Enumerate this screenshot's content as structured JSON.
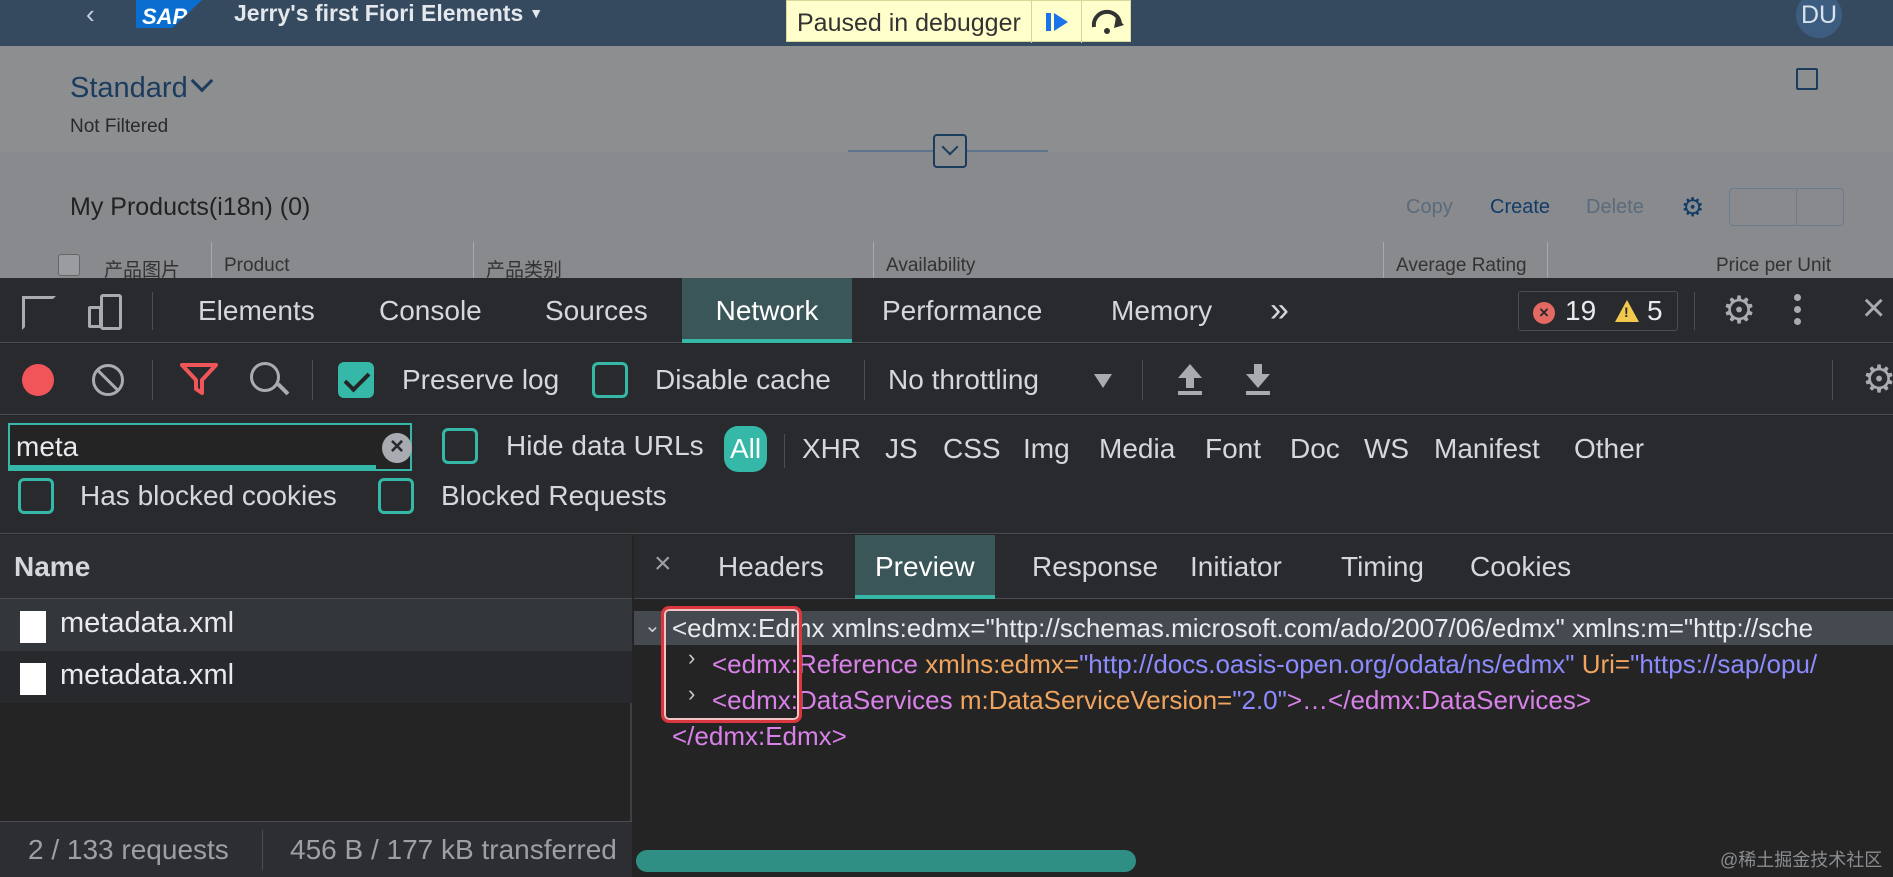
{
  "fiori": {
    "back_icon": "chevron-left-icon",
    "logo_text": "SAP",
    "app_title": "Jerry's first Fiori Elements",
    "debugger_text": "Paused in debugger",
    "avatar_initials": "DU",
    "variant": "Standard",
    "filter_status": "Not Filtered",
    "table_title": "My Products(i18n) (0)",
    "actions": {
      "copy": "Copy",
      "create": "Create",
      "delete": "Delete"
    },
    "columns": [
      "产品图片",
      "Product",
      "产品类别",
      "Availability",
      "Average Rating",
      "Price per Unit"
    ]
  },
  "devtools": {
    "tabs": [
      "Elements",
      "Console",
      "Sources",
      "Network",
      "Performance",
      "Memory"
    ],
    "more_tabs": "»",
    "active_tab": "Network",
    "error_count": "19",
    "warning_count": "5",
    "toolbar": {
      "preserve_log": "Preserve log",
      "preserve_log_checked": true,
      "disable_cache": "Disable cache",
      "throttling": "No throttling"
    },
    "filter": {
      "value": "meta",
      "hide_data_urls": "Hide data URLs",
      "types": [
        "All",
        "XHR",
        "JS",
        "CSS",
        "Img",
        "Media",
        "Font",
        "Doc",
        "WS",
        "Manifest",
        "Other"
      ],
      "active_type": "All",
      "has_blocked_cookies": "Has blocked cookies",
      "blocked_requests": "Blocked Requests"
    },
    "requests": {
      "header": "Name",
      "rows": [
        "metadata.xml",
        "metadata.xml"
      ],
      "summary_count": "2 / 133 requests",
      "summary_transfer": "456 B / 177 kB transferred"
    },
    "detail": {
      "close": "×",
      "tabs": [
        "Headers",
        "Preview",
        "Response",
        "Initiator",
        "Timing",
        "Cookies"
      ],
      "active_tab": "Preview",
      "xml": {
        "line1": "<edmx:Edmx xmlns:edmx=\"http://schemas.microsoft.com/ado/2007/06/edmx\" xmlns:m=\"http://sche",
        "line2_tag": "<edmx:Reference",
        "line2_attr1": " xmlns:edmx=",
        "line2_val1": "\"http://docs.oasis-open.org/odata/ns/edmx\"",
        "line2_attr2": " Uri=",
        "line2_val2": "\"https://sap/opu/",
        "line3_tag": "<edmx:DataServices",
        "line3_attr": " m:DataServiceVersion=",
        "line3_val": "\"2.0\"",
        "line3_rest": ">…</edmx:DataServices>",
        "line4": "</edmx:Edmx>"
      }
    }
  },
  "watermark": "@稀土掘金技术社区",
  "colors": {
    "accent": "#35b8a8",
    "shell": "#354a5f",
    "debugger_bg": "#ffffcc",
    "highlight_box": "#d9363e"
  }
}
